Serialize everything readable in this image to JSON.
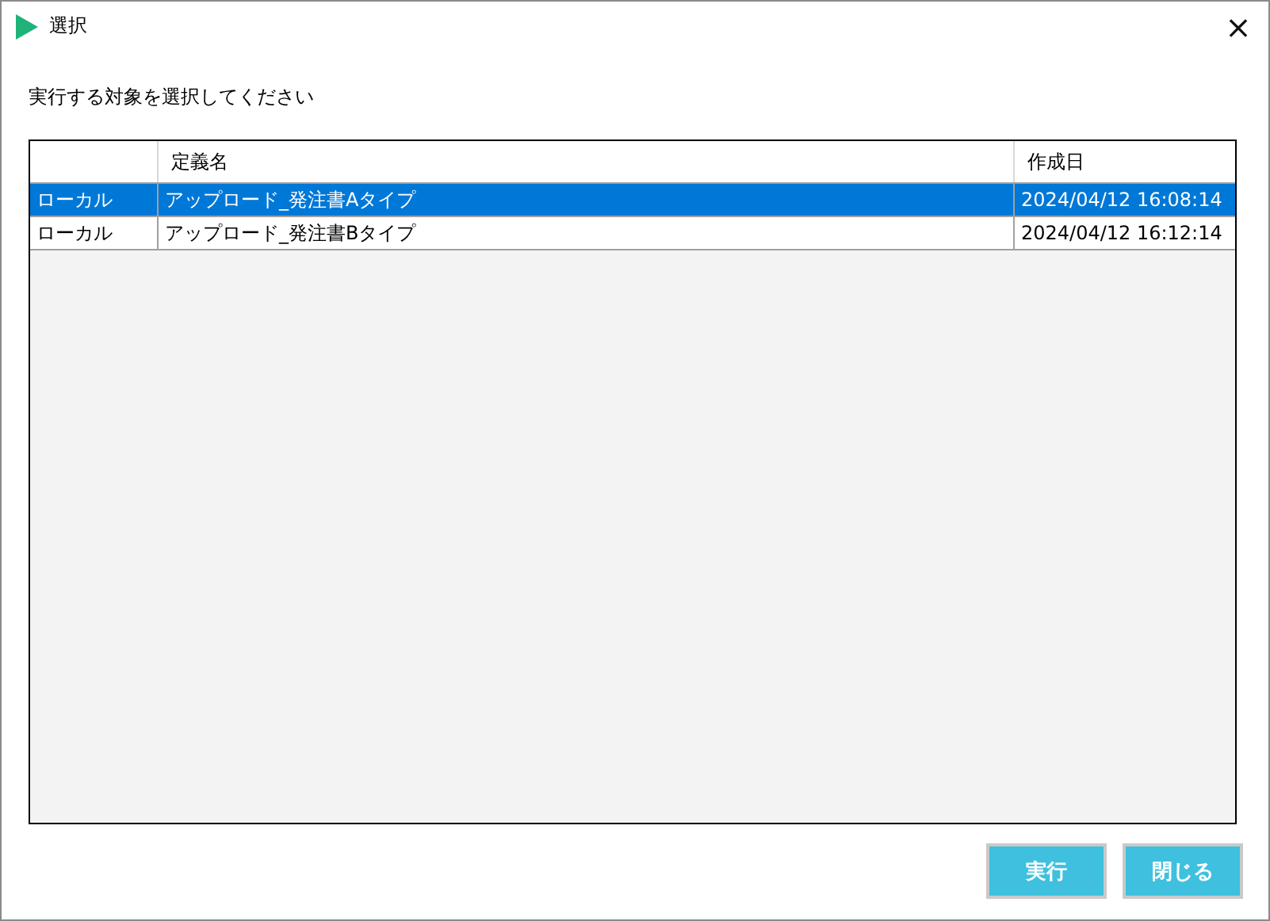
{
  "window": {
    "title": "選択",
    "close": "×"
  },
  "prompt": "実行する対象を選択してください",
  "table": {
    "columns": [
      "",
      "定義名",
      "作成日"
    ],
    "rows": [
      {
        "cells": [
          "ローカル",
          "アップロード_発注書Aタイプ",
          "2024/04/12 16:08:14"
        ],
        "selected": true
      },
      {
        "cells": [
          "ローカル",
          "アップロード_発注書Bタイプ",
          "2024/04/12 16:12:14"
        ],
        "selected": false
      }
    ]
  },
  "buttons": [
    "実行",
    "閉じる"
  ]
}
